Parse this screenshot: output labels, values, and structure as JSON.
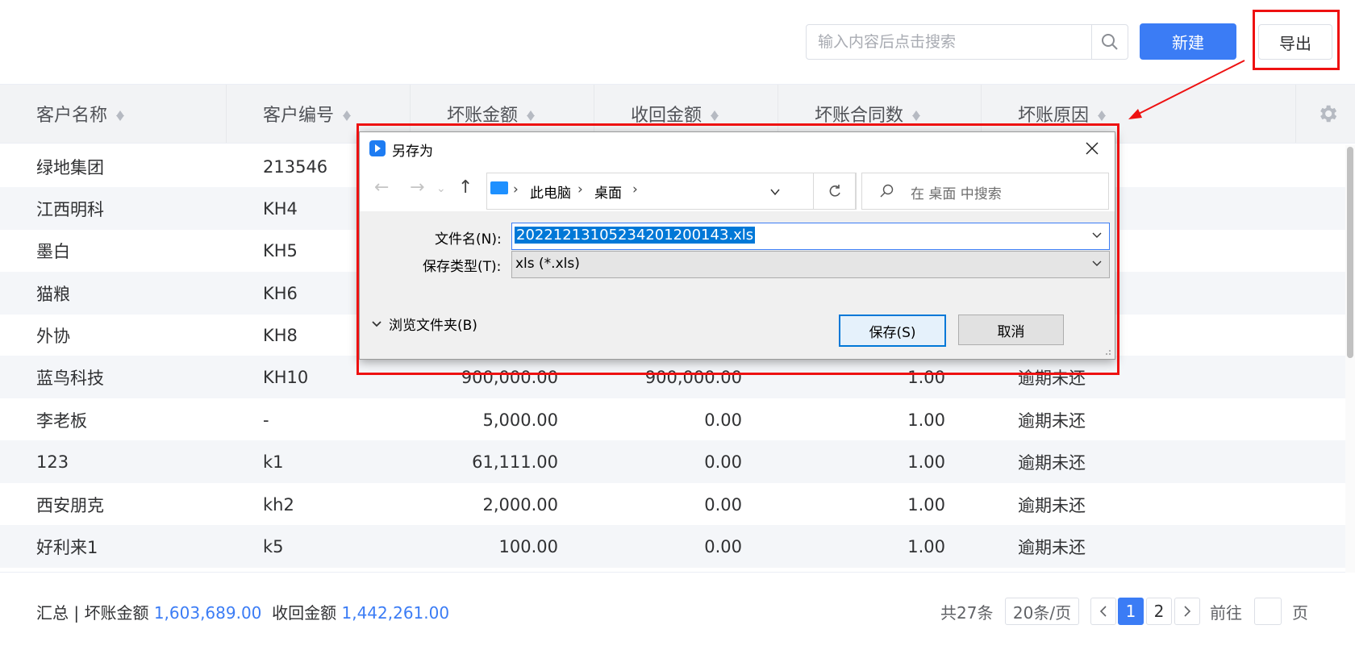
{
  "toolbar": {
    "search_placeholder": "输入内容后点击搜索",
    "new_label": "新建",
    "export_label": "导出"
  },
  "table": {
    "columns": [
      "客户名称",
      "客户编号",
      "坏账金额",
      "收回金额",
      "坏账合同数",
      "坏账原因"
    ],
    "rows": [
      {
        "name": "绿地集团",
        "code": "213546",
        "bad": "",
        "recovered": "",
        "contracts": "",
        "reason": ""
      },
      {
        "name": "江西明科",
        "code": "KH4",
        "bad": "",
        "recovered": "",
        "contracts": "",
        "reason": ""
      },
      {
        "name": "墨白",
        "code": "KH5",
        "bad": "",
        "recovered": "",
        "contracts": "",
        "reason": ""
      },
      {
        "name": "猫粮",
        "code": "KH6",
        "bad": "",
        "recovered": "",
        "contracts": "",
        "reason": ""
      },
      {
        "name": "外协",
        "code": "KH8",
        "bad": "",
        "recovered": "",
        "contracts": "",
        "reason": ""
      },
      {
        "name": "蓝鸟科技",
        "code": "KH10",
        "bad": "900,000.00",
        "recovered": "900,000.00",
        "contracts": "1.00",
        "reason": "逾期未还"
      },
      {
        "name": "李老板",
        "code": "-",
        "bad": "5,000.00",
        "recovered": "0.00",
        "contracts": "1.00",
        "reason": "逾期未还"
      },
      {
        "name": "123",
        "code": "k1",
        "bad": "61,111.00",
        "recovered": "0.00",
        "contracts": "1.00",
        "reason": "逾期未还"
      },
      {
        "name": "西安朋克",
        "code": "kh2",
        "bad": "2,000.00",
        "recovered": "0.00",
        "contracts": "1.00",
        "reason": "逾期未还"
      },
      {
        "name": "好利来1",
        "code": "k5",
        "bad": "100.00",
        "recovered": "0.00",
        "contracts": "1.00",
        "reason": "逾期未还"
      }
    ]
  },
  "footer": {
    "summary_label": "汇总 | 坏账金额",
    "bad_total": "1,603,689.00",
    "recovered_label": "收回金额",
    "recovered_total": "1,442,261.00",
    "total_text": "共27条",
    "page_size": "20条/页",
    "pages": [
      "1",
      "2"
    ],
    "current_page": "1",
    "goto_label": "前往",
    "page_suffix": "页"
  },
  "dialog": {
    "title": "另存为",
    "breadcrumb": [
      "此电脑",
      "桌面"
    ],
    "search_placeholder": "在 桌面 中搜索",
    "filename_label": "文件名(N):",
    "filename_value": "20221213105234201200143.xls",
    "filetype_label": "保存类型(T):",
    "filetype_value": "xls (*.xls)",
    "browse_label": "浏览文件夹(B)",
    "save_label": "保存(S)",
    "cancel_label": "取消"
  },
  "colors": {
    "primary": "#3b7cf5",
    "highlight": "#ee1111"
  }
}
